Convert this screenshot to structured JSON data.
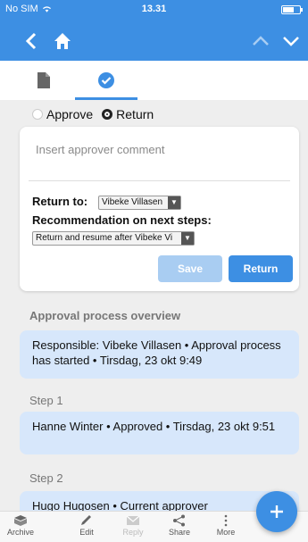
{
  "status_bar": {
    "carrier": "No SIM",
    "time": "13.31"
  },
  "nav": {
    "back_icon": "chevron-left-icon",
    "home_icon": "home-icon",
    "up_icon": "chevron-up-icon",
    "down_icon": "chevron-down-icon"
  },
  "tabs": [
    {
      "icon": "document-icon",
      "active": false
    },
    {
      "icon": "check-circle-icon",
      "active": true
    }
  ],
  "decision": {
    "approve_label": "Approve",
    "return_label": "Return",
    "selected": "Return"
  },
  "form": {
    "comment_placeholder": "Insert approver comment",
    "return_to_label": "Return to:",
    "return_to_value": "Vibeke Villasen",
    "recommendation_label": "Recommendation on next steps:",
    "recommendation_value": "Return and resume after Vibeke Vi",
    "save_label": "Save",
    "return_button_label": "Return"
  },
  "overview": {
    "title": "Approval process overview",
    "intro": "Responsible: Vibeke Villasen • Approval process has started • Tirsdag, 23 okt 9:49",
    "steps": [
      {
        "title": "Step 1",
        "text": "Hanne Winter • Approved • Tirsdag, 23 okt 9:51"
      },
      {
        "title": "Step 2",
        "text": "Hugo Hugosen • Current approver"
      }
    ]
  },
  "bottom_bar": [
    {
      "label": "Archive",
      "icon": "archive-icon",
      "enabled": true
    },
    {
      "label": "Edit",
      "icon": "pencil-icon",
      "enabled": true
    },
    {
      "label": "Reply",
      "icon": "mail-icon",
      "enabled": false
    },
    {
      "label": "Share",
      "icon": "share-icon",
      "enabled": true
    },
    {
      "label": "More",
      "icon": "more-vertical-icon",
      "enabled": true
    }
  ],
  "fab": {
    "icon": "plus-icon"
  },
  "colors": {
    "accent": "#3d8fe3",
    "entry_bg": "#d7e7fb",
    "disabled_button": "#a9cdf2"
  }
}
